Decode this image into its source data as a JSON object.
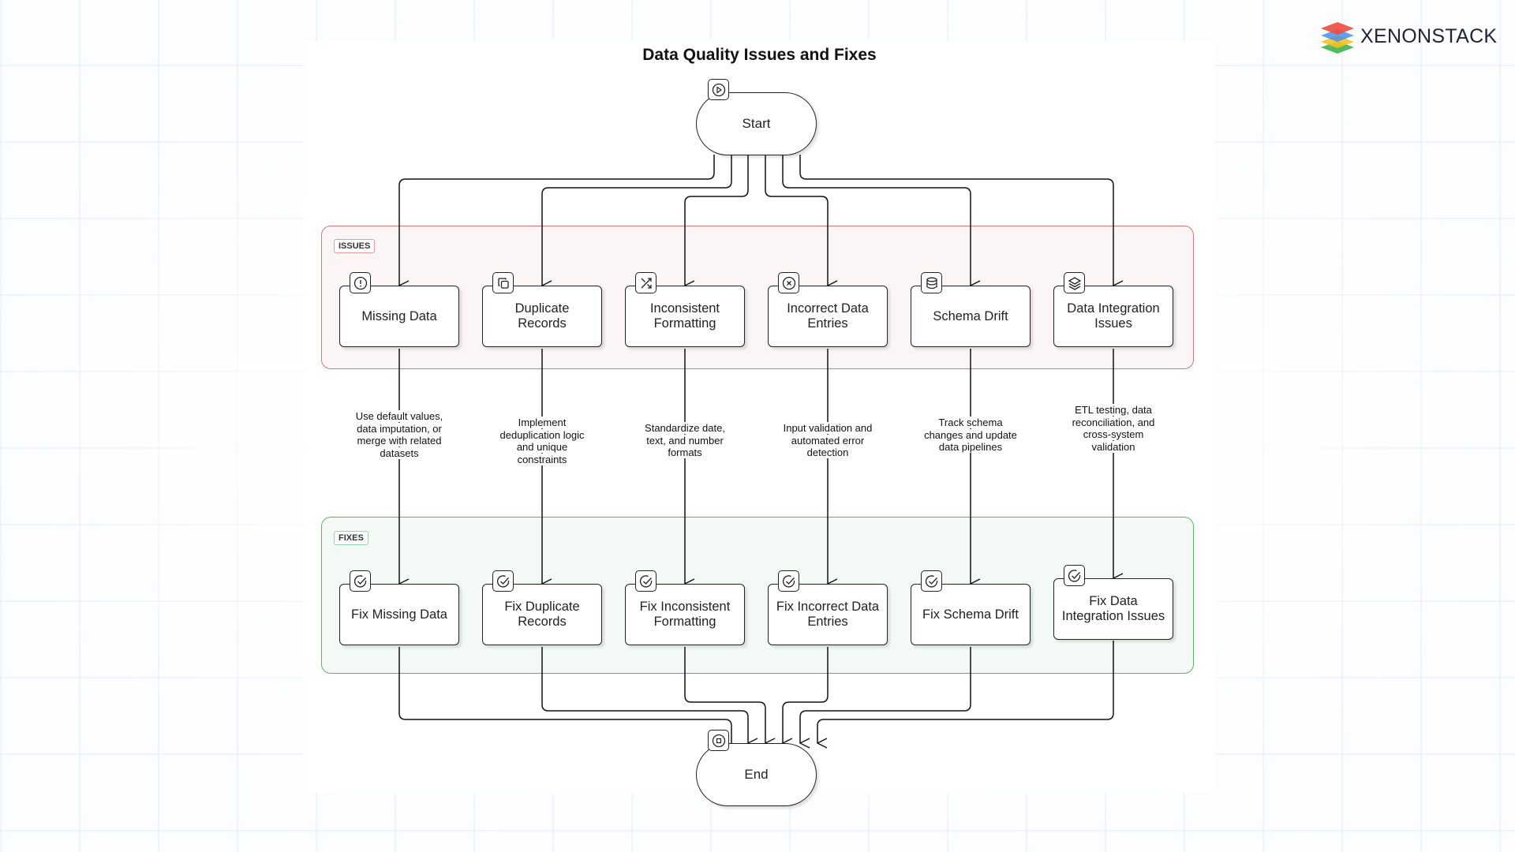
{
  "branding": {
    "logo_text": "XENONSTACK",
    "logo_icon": "stacked-layers-logo-icon"
  },
  "diagram": {
    "title": "Data Quality Issues and Fixes",
    "start": {
      "label": "Start",
      "icon": "play-circle-icon"
    },
    "end": {
      "label": "End",
      "icon": "stop-circle-icon"
    },
    "groups": {
      "issues": {
        "label": "ISSUES",
        "color": "#d9777a"
      },
      "fixes": {
        "label": "FIXES",
        "color": "#5cb36b"
      }
    },
    "issues": [
      {
        "label": "Missing Data",
        "icon": "alert-circle-icon"
      },
      {
        "label": "Duplicate Records",
        "icon": "copy-icon"
      },
      {
        "label": "Inconsistent Formatting",
        "icon": "shuffle-icon"
      },
      {
        "label": "Incorrect Data Entries",
        "icon": "x-circle-icon"
      },
      {
        "label": "Schema Drift",
        "icon": "database-icon"
      },
      {
        "label": "Data Integration Issues",
        "icon": "layers-icon"
      }
    ],
    "edge_labels": [
      "Use default values, data imputation, or merge with related datasets",
      "Implement deduplication logic and unique constraints",
      "Standardize date, text, and number formats",
      "Input validation and automated error detection",
      "Track schema changes and update data pipelines",
      "ETL testing, data reconciliation, and cross-system validation"
    ],
    "fixes": [
      {
        "label": "Fix Missing Data",
        "icon": "check-circle-icon"
      },
      {
        "label": "Fix Duplicate Records",
        "icon": "check-circle-icon"
      },
      {
        "label": "Fix Inconsistent Formatting",
        "icon": "check-circle-icon"
      },
      {
        "label": "Fix Incorrect Data Entries",
        "icon": "check-circle-icon"
      },
      {
        "label": "Fix Schema Drift",
        "icon": "check-circle-icon"
      },
      {
        "label": "Fix Data Integration Issues",
        "icon": "check-circle-icon"
      }
    ]
  }
}
